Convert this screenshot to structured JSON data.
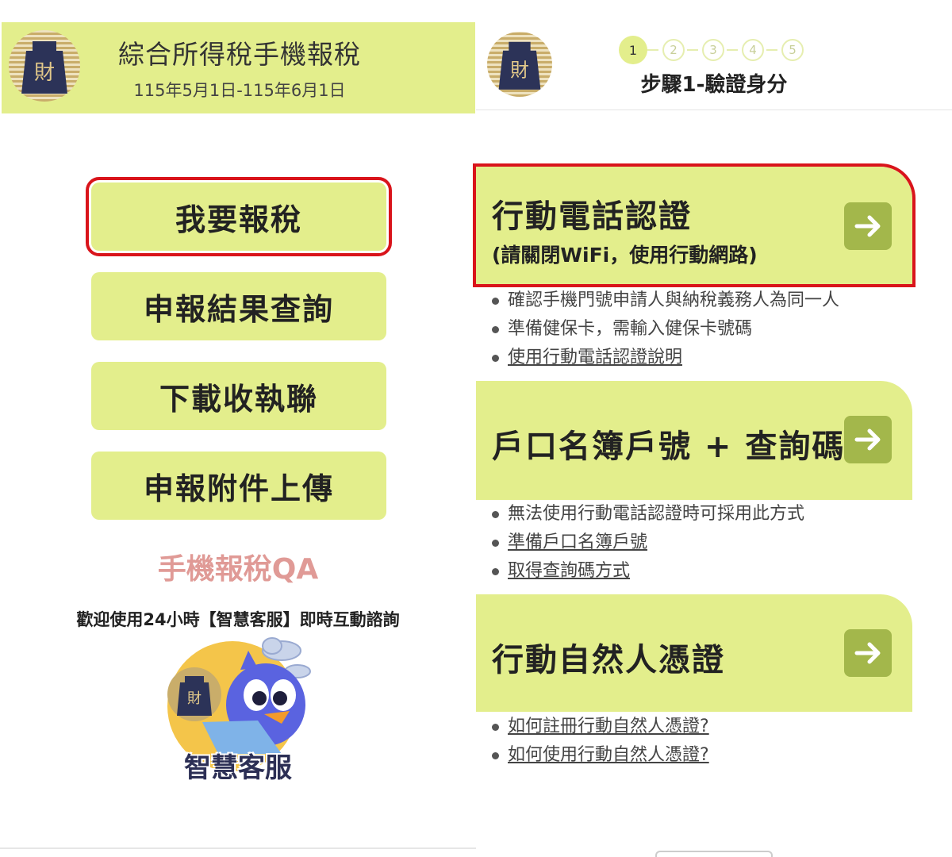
{
  "left": {
    "title": "綜合所得稅手機報稅",
    "date_range": "115年5月1日-115年6月1日",
    "logo_glyph": "財",
    "menu": [
      {
        "label": "我要報稅",
        "highlighted": true
      },
      {
        "label": "申報結果查詢"
      },
      {
        "label": "下載收執聯"
      },
      {
        "label": "申報附件上傳"
      }
    ],
    "qa_title": "手機報稅QA",
    "welcome_text": "歡迎使用24小時【智慧客服】即時互動諮詢",
    "chatbot_label": "智慧客服"
  },
  "right": {
    "logo_glyph": "財",
    "steps": [
      "1",
      "2",
      "3",
      "4",
      "5"
    ],
    "active_step": 1,
    "step_caption": "步驟1-驗證身分",
    "options": [
      {
        "title": "行動電話認證",
        "subtitle": "(請關閉WiFi，使用行動網路)",
        "highlighted": true,
        "notes": [
          {
            "text": "確認手機門號申請人與納稅義務人為同一人",
            "link": false
          },
          {
            "text": "準備健保卡，需輸入健保卡號碼",
            "link": false
          },
          {
            "text": "使用行動電話認證說明",
            "link": true
          }
        ]
      },
      {
        "title": "戶口名簿戶號 + 查詢碼",
        "notes": [
          {
            "text": "無法使用行動電話認證時可採用此方式",
            "link": false
          },
          {
            "text": "準備戶口名簿戶號",
            "link": true
          },
          {
            "text": "取得查詢碼方式",
            "link": true
          }
        ]
      },
      {
        "title": "行動自然人憑證",
        "notes": [
          {
            "text": "如何註冊行動自然人憑證?",
            "link": true
          },
          {
            "text": "如何使用行動自然人憑證?",
            "link": true
          }
        ]
      }
    ]
  },
  "colors": {
    "accent_green": "#e3ee8c",
    "arrow_green": "#a3b74b",
    "highlight_red": "#d9141b",
    "qa_pink": "#e09a96",
    "logo_navy": "#2c3358",
    "logo_gold": "#c9ad6a"
  },
  "icons": {
    "arrow": "arrow-right-icon",
    "logo": "tax-bureau-logo-icon",
    "chatbot": "chatbot-bird-icon"
  }
}
